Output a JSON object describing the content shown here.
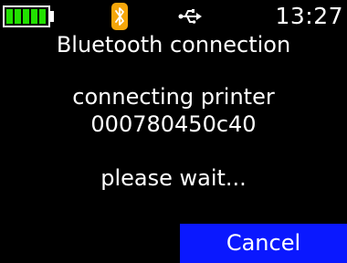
{
  "status_bar": {
    "battery": {
      "icon": "battery-icon",
      "level": 1.0,
      "fill_color": "#22e000"
    },
    "bluetooth": {
      "icon": "bluetooth-icon",
      "status": "active",
      "color": "#f5a60a"
    },
    "usb": {
      "icon": "usb-icon"
    },
    "time": "13:27"
  },
  "dialog": {
    "title": "Bluetooth connection",
    "message_line1": "connecting printer",
    "message_line2": "000780450c40",
    "message_line3": "please wait..."
  },
  "actions": {
    "cancel_label": "Cancel",
    "cancel_color": "#0a18ff"
  }
}
